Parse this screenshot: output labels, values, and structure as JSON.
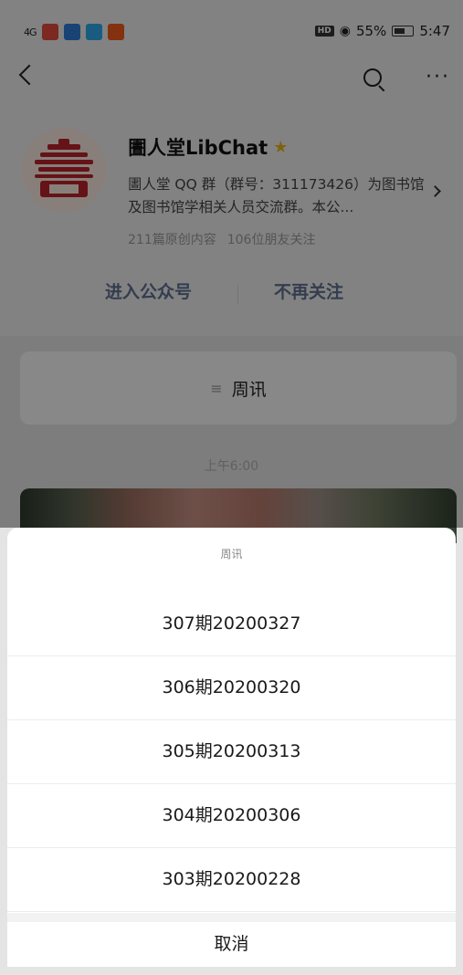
{
  "status_bar": {
    "signal": "4G",
    "battery": "55%",
    "time": "5:47",
    "hd_label": "HD"
  },
  "navbar": {
    "back_icon": "back-arrow-icon",
    "search_icon": "search-icon",
    "more_icon": "more-icon"
  },
  "profile": {
    "name": "圕人堂LibChat",
    "description": "圕人堂 QQ 群（群号：311173426）为图书馆及图书馆学相关人员交流群。本公...",
    "original_count": "211篇原创内容",
    "followers": "106位朋友关注",
    "actions": {
      "enter": "进入公众号",
      "unfollow": "不再关注"
    }
  },
  "menu": {
    "label": "周讯"
  },
  "timestamp": "上午6:00",
  "sheet": {
    "title": "周讯",
    "items": [
      "307期20200327",
      "306期20200320",
      "305期20200313",
      "304期20200306",
      "303期20200228"
    ],
    "cancel": "取消"
  }
}
